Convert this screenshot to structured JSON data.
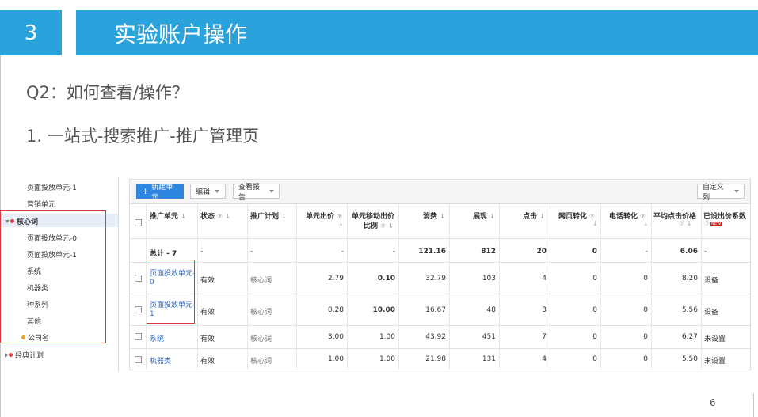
{
  "slide": {
    "number": "3",
    "title": "实验账户操作",
    "question": "Q2：如何查看/操作？",
    "step": "1. 一站式-搜索推广-推广管理页",
    "page_number": "6"
  },
  "sidebar": {
    "items_top": [
      "页面投放单元-1",
      "营销单元"
    ],
    "group": "核心词",
    "group_children": [
      "页面投放单元-0",
      "页面投放单元-1",
      "系统",
      "机器类",
      "种系列",
      "其他",
      "公司名"
    ],
    "footer_group": "经典计划",
    "colors": {
      "group_dot": "#e03a3a",
      "child_dot": "#f0a020",
      "footer_dot": "#e03a3a"
    }
  },
  "toolbar": {
    "new_unit": "新建单元",
    "new_unit_icon": "+",
    "edit": "编辑",
    "report": "查看报告",
    "custom_columns": "自定义列"
  },
  "table": {
    "headers": {
      "unit": "推广单元",
      "status": "状态",
      "plan": "推广计划",
      "bid": "单元出价",
      "mobile_bid_1": "单元移动出价",
      "mobile_bid_2": "比例",
      "cost": "消费",
      "impressions": "展现",
      "clicks": "点击",
      "web_conv": "网页转化",
      "phone_conv": "电话转化",
      "avg_cpc": "平均点击价格",
      "bid_coef": "已设出价系数",
      "new_badge": "NEW"
    },
    "total": {
      "label": "总计 - 7",
      "status": "-",
      "plan": "-",
      "bid": "-",
      "mobile_ratio": "-",
      "cost": "121.16",
      "impressions": "812",
      "clicks": "20",
      "web_conv": "0",
      "phone_conv": "-",
      "avg_cpc": "6.06",
      "bid_coef": "-"
    },
    "rows": [
      {
        "unit_1": "页面投放单元-",
        "unit_2": "0",
        "status": "有效",
        "plan": "核心词",
        "bid": "2.79",
        "mobile_ratio": "0.10",
        "cost": "32.79",
        "impressions": "103",
        "clicks": "4",
        "web_conv": "0",
        "phone_conv": "0",
        "avg_cpc": "8.20",
        "bid_coef": "设备"
      },
      {
        "unit_1": "页面投放单元-",
        "unit_2": "1",
        "status": "有效",
        "plan": "核心词",
        "bid": "0.28",
        "mobile_ratio": "10.00",
        "cost": "16.67",
        "impressions": "48",
        "clicks": "3",
        "web_conv": "0",
        "phone_conv": "0",
        "avg_cpc": "5.56",
        "bid_coef": "设备"
      },
      {
        "unit_1": "系统",
        "unit_2": "",
        "status": "有效",
        "plan": "核心词",
        "bid": "3.00",
        "mobile_ratio": "1.00",
        "cost": "43.92",
        "impressions": "451",
        "clicks": "7",
        "web_conv": "0",
        "phone_conv": "0",
        "avg_cpc": "6.27",
        "bid_coef": "未设置"
      },
      {
        "unit_1": "机器类",
        "unit_2": "",
        "status": "有效",
        "plan": "核心词",
        "bid": "1.00",
        "mobile_ratio": "1.00",
        "cost": "21.98",
        "impressions": "131",
        "clicks": "4",
        "web_conv": "0",
        "phone_conv": "0",
        "avg_cpc": "5.50",
        "bid_coef": "未设置"
      }
    ],
    "sort_glyph": "↓",
    "help_glyph": "⑦"
  },
  "colors": {
    "accent": "#2aa3dc",
    "highlight_box": "#d63a3a",
    "link": "#2a6ac8"
  }
}
